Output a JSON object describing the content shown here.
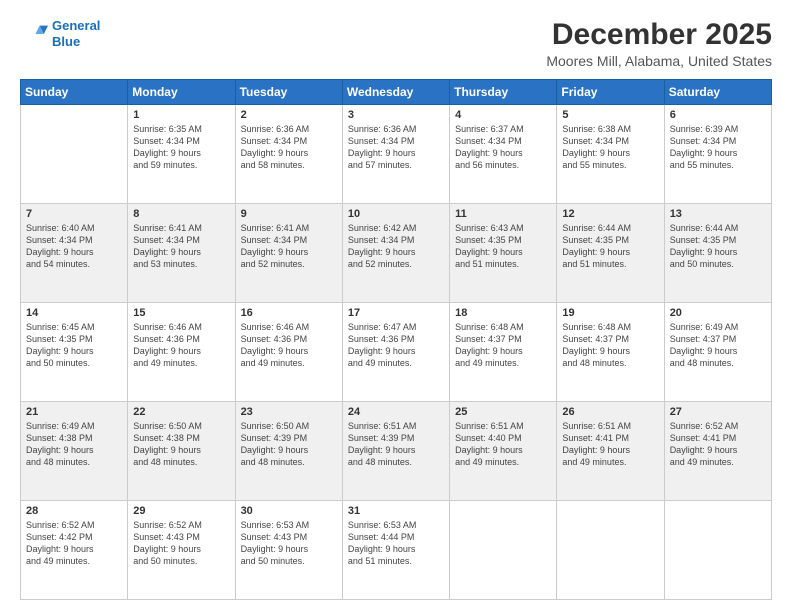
{
  "header": {
    "logo_line1": "General",
    "logo_line2": "Blue",
    "title": "December 2025",
    "subtitle": "Moores Mill, Alabama, United States"
  },
  "days_of_week": [
    "Sunday",
    "Monday",
    "Tuesday",
    "Wednesday",
    "Thursday",
    "Friday",
    "Saturday"
  ],
  "weeks": [
    [
      {
        "day": "",
        "info": ""
      },
      {
        "day": "1",
        "info": "Sunrise: 6:35 AM\nSunset: 4:34 PM\nDaylight: 9 hours\nand 59 minutes."
      },
      {
        "day": "2",
        "info": "Sunrise: 6:36 AM\nSunset: 4:34 PM\nDaylight: 9 hours\nand 58 minutes."
      },
      {
        "day": "3",
        "info": "Sunrise: 6:36 AM\nSunset: 4:34 PM\nDaylight: 9 hours\nand 57 minutes."
      },
      {
        "day": "4",
        "info": "Sunrise: 6:37 AM\nSunset: 4:34 PM\nDaylight: 9 hours\nand 56 minutes."
      },
      {
        "day": "5",
        "info": "Sunrise: 6:38 AM\nSunset: 4:34 PM\nDaylight: 9 hours\nand 55 minutes."
      },
      {
        "day": "6",
        "info": "Sunrise: 6:39 AM\nSunset: 4:34 PM\nDaylight: 9 hours\nand 55 minutes."
      }
    ],
    [
      {
        "day": "7",
        "info": "Sunrise: 6:40 AM\nSunset: 4:34 PM\nDaylight: 9 hours\nand 54 minutes."
      },
      {
        "day": "8",
        "info": "Sunrise: 6:41 AM\nSunset: 4:34 PM\nDaylight: 9 hours\nand 53 minutes."
      },
      {
        "day": "9",
        "info": "Sunrise: 6:41 AM\nSunset: 4:34 PM\nDaylight: 9 hours\nand 52 minutes."
      },
      {
        "day": "10",
        "info": "Sunrise: 6:42 AM\nSunset: 4:34 PM\nDaylight: 9 hours\nand 52 minutes."
      },
      {
        "day": "11",
        "info": "Sunrise: 6:43 AM\nSunset: 4:35 PM\nDaylight: 9 hours\nand 51 minutes."
      },
      {
        "day": "12",
        "info": "Sunrise: 6:44 AM\nSunset: 4:35 PM\nDaylight: 9 hours\nand 51 minutes."
      },
      {
        "day": "13",
        "info": "Sunrise: 6:44 AM\nSunset: 4:35 PM\nDaylight: 9 hours\nand 50 minutes."
      }
    ],
    [
      {
        "day": "14",
        "info": "Sunrise: 6:45 AM\nSunset: 4:35 PM\nDaylight: 9 hours\nand 50 minutes."
      },
      {
        "day": "15",
        "info": "Sunrise: 6:46 AM\nSunset: 4:36 PM\nDaylight: 9 hours\nand 49 minutes."
      },
      {
        "day": "16",
        "info": "Sunrise: 6:46 AM\nSunset: 4:36 PM\nDaylight: 9 hours\nand 49 minutes."
      },
      {
        "day": "17",
        "info": "Sunrise: 6:47 AM\nSunset: 4:36 PM\nDaylight: 9 hours\nand 49 minutes."
      },
      {
        "day": "18",
        "info": "Sunrise: 6:48 AM\nSunset: 4:37 PM\nDaylight: 9 hours\nand 49 minutes."
      },
      {
        "day": "19",
        "info": "Sunrise: 6:48 AM\nSunset: 4:37 PM\nDaylight: 9 hours\nand 48 minutes."
      },
      {
        "day": "20",
        "info": "Sunrise: 6:49 AM\nSunset: 4:37 PM\nDaylight: 9 hours\nand 48 minutes."
      }
    ],
    [
      {
        "day": "21",
        "info": "Sunrise: 6:49 AM\nSunset: 4:38 PM\nDaylight: 9 hours\nand 48 minutes."
      },
      {
        "day": "22",
        "info": "Sunrise: 6:50 AM\nSunset: 4:38 PM\nDaylight: 9 hours\nand 48 minutes."
      },
      {
        "day": "23",
        "info": "Sunrise: 6:50 AM\nSunset: 4:39 PM\nDaylight: 9 hours\nand 48 minutes."
      },
      {
        "day": "24",
        "info": "Sunrise: 6:51 AM\nSunset: 4:39 PM\nDaylight: 9 hours\nand 48 minutes."
      },
      {
        "day": "25",
        "info": "Sunrise: 6:51 AM\nSunset: 4:40 PM\nDaylight: 9 hours\nand 49 minutes."
      },
      {
        "day": "26",
        "info": "Sunrise: 6:51 AM\nSunset: 4:41 PM\nDaylight: 9 hours\nand 49 minutes."
      },
      {
        "day": "27",
        "info": "Sunrise: 6:52 AM\nSunset: 4:41 PM\nDaylight: 9 hours\nand 49 minutes."
      }
    ],
    [
      {
        "day": "28",
        "info": "Sunrise: 6:52 AM\nSunset: 4:42 PM\nDaylight: 9 hours\nand 49 minutes."
      },
      {
        "day": "29",
        "info": "Sunrise: 6:52 AM\nSunset: 4:43 PM\nDaylight: 9 hours\nand 50 minutes."
      },
      {
        "day": "30",
        "info": "Sunrise: 6:53 AM\nSunset: 4:43 PM\nDaylight: 9 hours\nand 50 minutes."
      },
      {
        "day": "31",
        "info": "Sunrise: 6:53 AM\nSunset: 4:44 PM\nDaylight: 9 hours\nand 51 minutes."
      },
      {
        "day": "",
        "info": ""
      },
      {
        "day": "",
        "info": ""
      },
      {
        "day": "",
        "info": ""
      }
    ]
  ]
}
